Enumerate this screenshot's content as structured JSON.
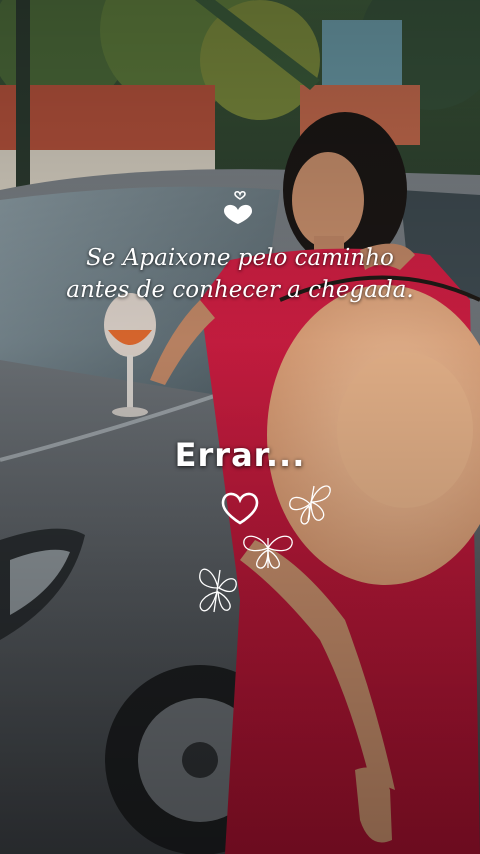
{
  "overlay": {
    "quote_line_1": "Se Apaixone pelo caminho",
    "quote_line_2": "antes de conhecer a chegada.",
    "title": "Errar..."
  },
  "icons": [
    "hearts-icon",
    "heart-outline-icon",
    "butterfly-icon",
    "butterfly-icon",
    "butterfly-icon"
  ],
  "colors": {
    "text": "#ffffff",
    "dress": "#c4163c",
    "hat": "#e9b48f",
    "car": "#6d7277",
    "roof": "#b5523c"
  }
}
